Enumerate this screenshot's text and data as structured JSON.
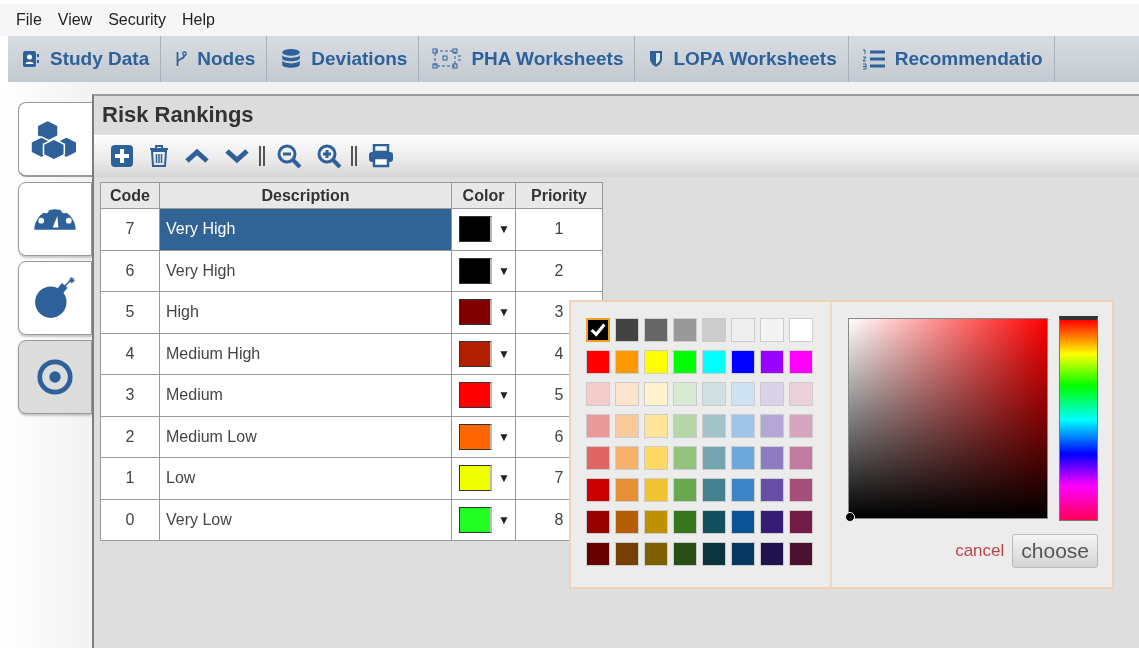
{
  "menu_bar": [
    "File",
    "View",
    "Security",
    "Help"
  ],
  "nav_tabs": [
    {
      "label": "Study Data"
    },
    {
      "label": "Nodes"
    },
    {
      "label": "Deviations"
    },
    {
      "label": "PHA Worksheets"
    },
    {
      "label": "LOPA Worksheets"
    },
    {
      "label": "Recommendatio"
    }
  ],
  "side_tabs": [
    {
      "selected": true,
      "hovered": false
    },
    {
      "selected": false,
      "hovered": false
    },
    {
      "selected": false,
      "hovered": false
    },
    {
      "selected": false,
      "hovered": true
    }
  ],
  "panel": {
    "title": "Risk Rankings",
    "table": {
      "columns": [
        "Code",
        "Description",
        "Color",
        "Priority"
      ],
      "rows": [
        {
          "code": "7",
          "description": "Very High",
          "color": "#000000",
          "dropdown": "▼",
          "priority": "1",
          "selected": true
        },
        {
          "code": "6",
          "description": "Very High",
          "color": "#000000",
          "dropdown": "▼",
          "priority": "2",
          "selected": false
        },
        {
          "code": "5",
          "description": "High",
          "color": "#800000",
          "dropdown": "▼",
          "priority": "3",
          "selected": false
        },
        {
          "code": "4",
          "description": "Medium High",
          "color": "#b22000",
          "dropdown": "▼",
          "priority": "4",
          "selected": false
        },
        {
          "code": "3",
          "description": "Medium",
          "color": "#ff0000",
          "dropdown": "▼",
          "priority": "5",
          "selected": false
        },
        {
          "code": "2",
          "description": "Medium Low",
          "color": "#ff6600",
          "dropdown": "▼",
          "priority": "6",
          "selected": false
        },
        {
          "code": "1",
          "description": "Low",
          "color": "#eeff00",
          "dropdown": "▼",
          "priority": "7",
          "selected": false
        },
        {
          "code": "0",
          "description": "Very Low",
          "color": "#22ff22",
          "dropdown": "▼",
          "priority": "8",
          "selected": false
        }
      ]
    }
  },
  "color_picker": {
    "swatches": [
      {
        "color": "#000000",
        "selected": true
      },
      {
        "color": "#434343",
        "selected": false
      },
      {
        "color": "#666666",
        "selected": false
      },
      {
        "color": "#999999",
        "selected": false
      },
      {
        "color": "#cccccc",
        "selected": false
      },
      {
        "color": "#efefef",
        "selected": false
      },
      {
        "color": "#f3f3f3",
        "selected": false
      },
      {
        "color": "#ffffff",
        "selected": false
      },
      {
        "color": "#ff0000",
        "selected": false
      },
      {
        "color": "#ff9900",
        "selected": false
      },
      {
        "color": "#ffff00",
        "selected": false
      },
      {
        "color": "#00ff00",
        "selected": false
      },
      {
        "color": "#00ffff",
        "selected": false
      },
      {
        "color": "#0000ff",
        "selected": false
      },
      {
        "color": "#9900ff",
        "selected": false
      },
      {
        "color": "#ff00ff",
        "selected": false
      },
      {
        "color": "#f4cccc",
        "selected": false
      },
      {
        "color": "#fce5cd",
        "selected": false
      },
      {
        "color": "#fff2cc",
        "selected": false
      },
      {
        "color": "#d9ead3",
        "selected": false
      },
      {
        "color": "#d0e0e3",
        "selected": false
      },
      {
        "color": "#cfe2f3",
        "selected": false
      },
      {
        "color": "#d9d2e9",
        "selected": false
      },
      {
        "color": "#ead1dc",
        "selected": false
      },
      {
        "color": "#ea9999",
        "selected": false
      },
      {
        "color": "#f9cb9c",
        "selected": false
      },
      {
        "color": "#ffe599",
        "selected": false
      },
      {
        "color": "#b6d7a8",
        "selected": false
      },
      {
        "color": "#a2c4c9",
        "selected": false
      },
      {
        "color": "#9fc5e8",
        "selected": false
      },
      {
        "color": "#b4a7d6",
        "selected": false
      },
      {
        "color": "#d5a6bd",
        "selected": false
      },
      {
        "color": "#e06666",
        "selected": false
      },
      {
        "color": "#f6b26b",
        "selected": false
      },
      {
        "color": "#ffd966",
        "selected": false
      },
      {
        "color": "#93c47d",
        "selected": false
      },
      {
        "color": "#76a5af",
        "selected": false
      },
      {
        "color": "#6fa8dc",
        "selected": false
      },
      {
        "color": "#8e7cc3",
        "selected": false
      },
      {
        "color": "#c27ba0",
        "selected": false
      },
      {
        "color": "#cc0000",
        "selected": false
      },
      {
        "color": "#e69138",
        "selected": false
      },
      {
        "color": "#f1c232",
        "selected": false
      },
      {
        "color": "#6aa84f",
        "selected": false
      },
      {
        "color": "#45818e",
        "selected": false
      },
      {
        "color": "#3d85c6",
        "selected": false
      },
      {
        "color": "#674ea7",
        "selected": false
      },
      {
        "color": "#a64d79",
        "selected": false
      },
      {
        "color": "#990000",
        "selected": false
      },
      {
        "color": "#b45f06",
        "selected": false
      },
      {
        "color": "#bf9000",
        "selected": false
      },
      {
        "color": "#38761d",
        "selected": false
      },
      {
        "color": "#134f5c",
        "selected": false
      },
      {
        "color": "#0b5394",
        "selected": false
      },
      {
        "color": "#351c75",
        "selected": false
      },
      {
        "color": "#741b47",
        "selected": false
      },
      {
        "color": "#660000",
        "selected": false
      },
      {
        "color": "#783f04",
        "selected": false
      },
      {
        "color": "#7f6000",
        "selected": false
      },
      {
        "color": "#274e13",
        "selected": false
      },
      {
        "color": "#0c343d",
        "selected": false
      },
      {
        "color": "#073763",
        "selected": false
      },
      {
        "color": "#20124d",
        "selected": false
      },
      {
        "color": "#4c1130",
        "selected": false
      }
    ],
    "cancel": "cancel",
    "choose": "choose"
  }
}
